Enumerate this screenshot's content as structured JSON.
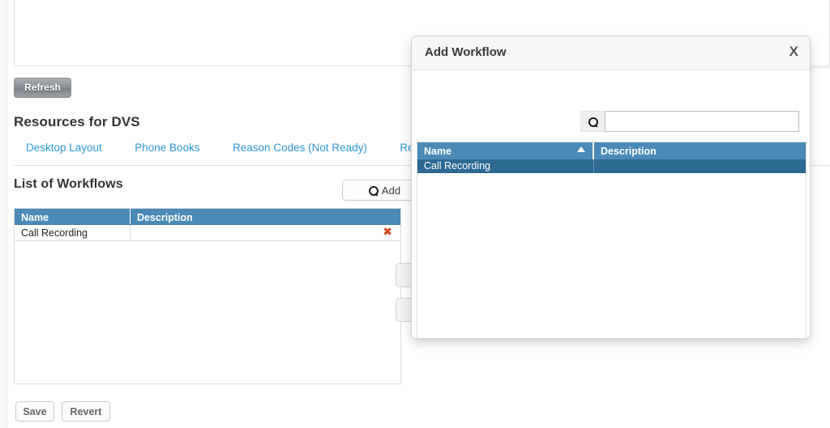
{
  "background": {
    "refresh_label": "Refresh",
    "resources_title": "Resources for DVS",
    "tabs": [
      {
        "label": "Desktop Layout"
      },
      {
        "label": "Phone Books"
      },
      {
        "label": "Reason Codes (Not Ready)"
      },
      {
        "label": "Reason Co"
      }
    ],
    "list_title": "List of Workflows",
    "add_label": "Add",
    "grid": {
      "columns": [
        "Name",
        "Description"
      ],
      "rows": [
        {
          "name": "Call Recording",
          "description": "",
          "delete_glyph": "✖"
        }
      ]
    },
    "footer": {
      "save_label": "Save",
      "revert_label": "Revert"
    }
  },
  "modal": {
    "title": "Add Workflow",
    "close_label": "X",
    "search": {
      "value": "",
      "placeholder": ""
    },
    "grid": {
      "columns": [
        "Name",
        "Description"
      ],
      "sort_column": "Name",
      "sort_direction": "asc",
      "rows": [
        {
          "name": "Call Recording",
          "description": "",
          "selected": true
        }
      ]
    }
  },
  "colors": {
    "table_header_blue": "#4a8ab7",
    "row_selected_blue": "#2d6a93",
    "link_blue": "#2f96d8",
    "delete_red": "#d9421a"
  }
}
